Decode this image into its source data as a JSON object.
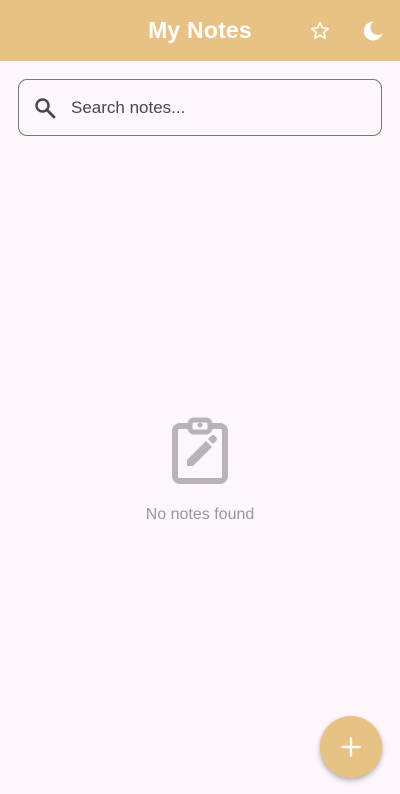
{
  "appbar": {
    "title": "My Notes",
    "background": "#e7c284",
    "actions": [
      {
        "icon": "star-outline-icon",
        "label": "Favorites"
      },
      {
        "icon": "moon-icon",
        "label": "Toggle theme"
      }
    ]
  },
  "search": {
    "placeholder": "Search notes...",
    "value": "",
    "icon": "search-icon"
  },
  "empty_state": {
    "icon": "clipboard-edit-icon",
    "message": "No notes found"
  },
  "fab": {
    "icon": "plus-icon",
    "color": "#e7c284"
  },
  "colors": {
    "background": "#fdf7fc",
    "accent": "#e7c284",
    "muted_text": "#9a969e",
    "icon_muted": "#b8b3bb"
  }
}
